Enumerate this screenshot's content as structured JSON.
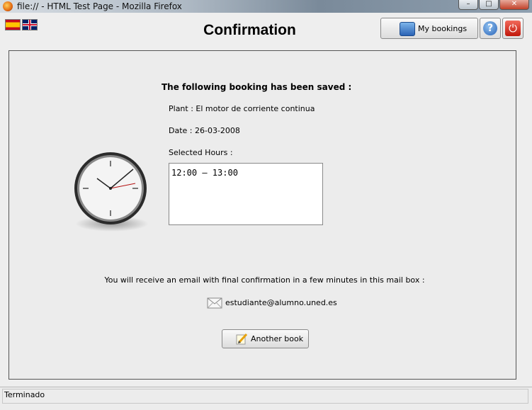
{
  "window": {
    "title": "file:// - HTML Test Page - Mozilla Firefox"
  },
  "languages": [
    {
      "name": "spanish-flag-icon"
    },
    {
      "name": "uk-flag-icon"
    }
  ],
  "header": {
    "title": "Confirmation",
    "my_bookings_label": "My bookings",
    "help_icon": "question-icon",
    "exit_icon": "power-icon"
  },
  "booking": {
    "heading": "The following booking has been saved :",
    "plant": "Plant : El motor de corriente continua",
    "date": "Date : 26-03-2008",
    "hours_label": "Selected Hours :",
    "hours_value": "12:00 – 13:00"
  },
  "email": {
    "note": "You will receive an email with final confirmation in a few minutes in this mail box :",
    "address": "estudiante@alumno.uned.es"
  },
  "actions": {
    "another_book_label": "Another book"
  },
  "status": {
    "text": "Terminado"
  }
}
